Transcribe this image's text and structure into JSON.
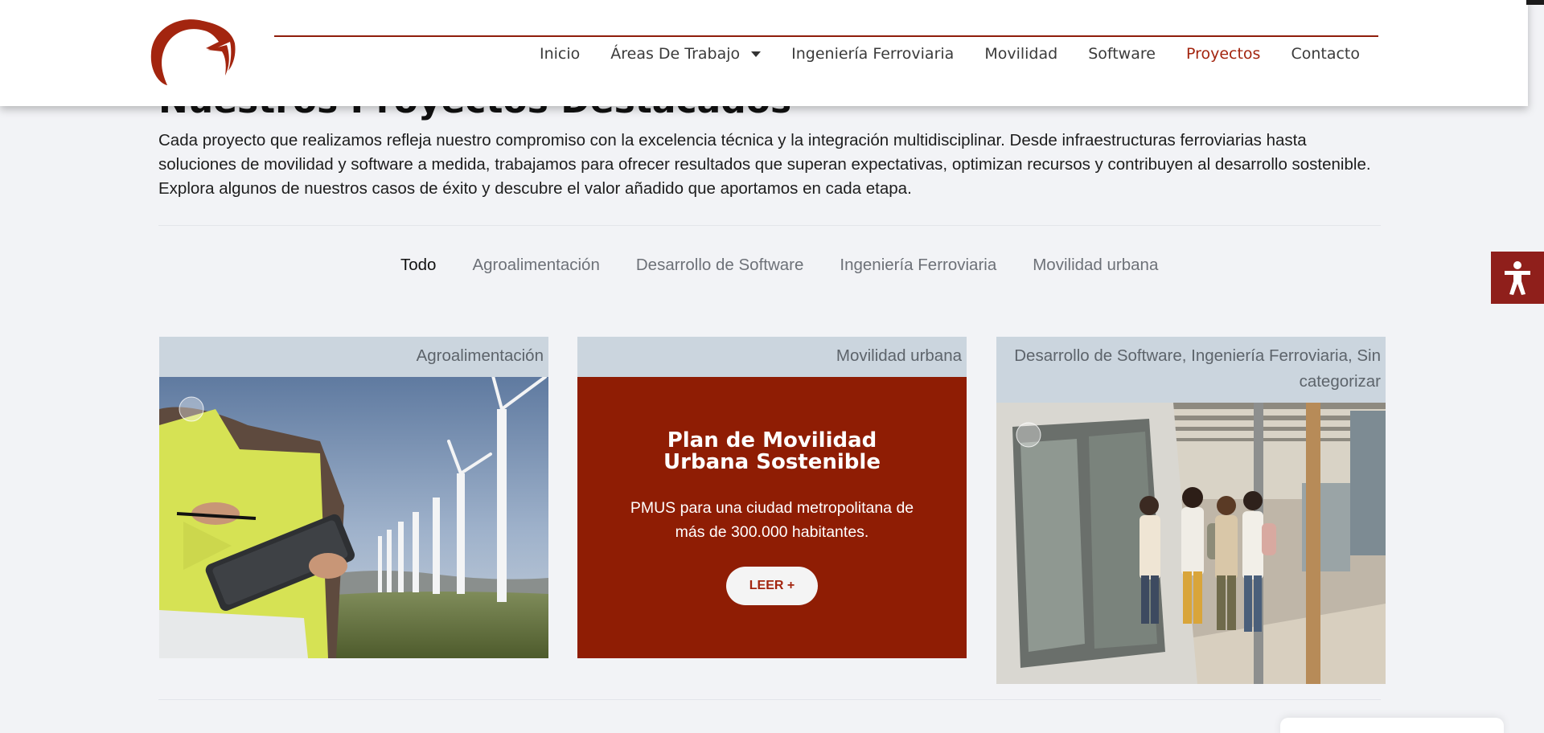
{
  "header": {
    "nav": [
      {
        "label": "Inicio"
      },
      {
        "label": "Áreas De Trabajo"
      },
      {
        "label": "Ingeniería Ferroviaria"
      },
      {
        "label": "Movilidad"
      },
      {
        "label": "Software"
      },
      {
        "label": "Proyectos"
      },
      {
        "label": "Contacto"
      }
    ],
    "active_nav": "Proyectos",
    "accent_color": "#a3250f"
  },
  "main": {
    "title": "Nuestros Proyectos Destacados",
    "intro": "Cada proyecto que realizamos refleja nuestro compromiso con la excelencia técnica y la integración multidisciplinar. Desde infraestructuras ferroviarias hasta soluciones de movilidad y software a medida, trabajamos para ofrecer resultados que superan expectativas, optimizan recursos y contribuyen al desarrollo sostenible. Explora algunos de nuestros casos de éxito y descubre el valor añadido que aportamos en cada etapa.",
    "filters": [
      "Todo",
      "Agroalimentación",
      "Desarrollo de Software",
      "Ingeniería Ferroviaria",
      "Movilidad urbana"
    ],
    "active_filter": "Todo",
    "cards": [
      {
        "category": "Agroalimentación"
      },
      {
        "category": "Movilidad urbana",
        "title": "Plan de Movilidad Urbana Sostenible",
        "description": "PMUS para una ciudad metropolitana de más de 300.000 habitantes.",
        "button": "LEER +"
      },
      {
        "category": "Desarrollo de Software, Ingeniería Ferroviaria, Sin categorizar"
      }
    ]
  },
  "colors": {
    "brand_red": "#8f1d04",
    "category_bg": "#cbd5de",
    "page_bg": "#f2f3f6"
  },
  "icons": [
    "logo-mark",
    "chevron-down-icon",
    "download-badge-icon",
    "accessibility-icon"
  ]
}
